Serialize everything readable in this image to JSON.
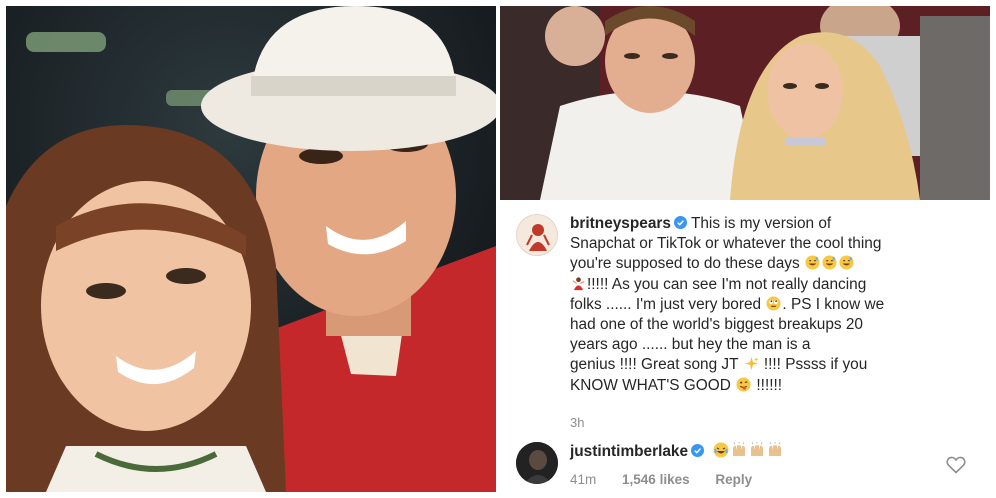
{
  "post": {
    "username": "britneyspears",
    "caption_lines": [
      "This is my version of",
      "Snapchat or TikTok or whatever the cool thing",
      "you're supposed to do these days",
      "!!!!! As you can see I'm not really dancing",
      "folks ...... I'm just very bored",
      ". PS I know we",
      "had one of the world's biggest breakups 20",
      "years ago ...... but hey the man is a",
      "genius !!!! Great song JT",
      "!!!! Pssss if you",
      "KNOW WHAT'S GOOD",
      "!!!!!!"
    ],
    "time_ago": "3h"
  },
  "comment": {
    "username": "justintimberlake",
    "time": "41m",
    "likes": "1,546 likes",
    "reply_label": "Reply"
  },
  "icons": {
    "verified": "verified-badge-icon",
    "heart": "heart-outline-icon"
  },
  "colors": {
    "verified_blue": "#3897f0",
    "text": "#262626",
    "muted": "#8e8e8e"
  }
}
